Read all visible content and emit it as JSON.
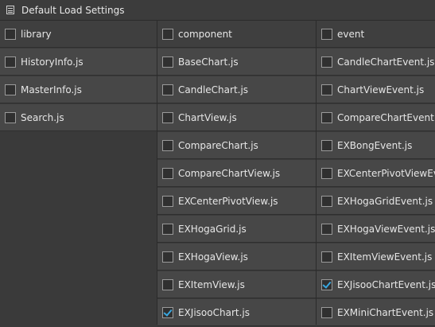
{
  "window": {
    "title": "Default Load Settings",
    "icon": "window-list-icon"
  },
  "columns": [
    {
      "items": [
        {
          "label": "library",
          "checked": false
        },
        {
          "label": "HistoryInfo.js",
          "checked": false
        },
        {
          "label": "MasterInfo.js",
          "checked": false
        },
        {
          "label": "Search.js",
          "checked": false
        }
      ]
    },
    {
      "items": [
        {
          "label": "component",
          "checked": false
        },
        {
          "label": "BaseChart.js",
          "checked": false
        },
        {
          "label": "CandleChart.js",
          "checked": false
        },
        {
          "label": "ChartView.js",
          "checked": false
        },
        {
          "label": "CompareChart.js",
          "checked": false
        },
        {
          "label": "CompareChartView.js",
          "checked": false
        },
        {
          "label": "EXCenterPivotView.js",
          "checked": false
        },
        {
          "label": "EXHogaGrid.js",
          "checked": false
        },
        {
          "label": "EXHogaView.js",
          "checked": false
        },
        {
          "label": "EXItemView.js",
          "checked": false
        },
        {
          "label": "EXJisooChart.js",
          "checked": true
        }
      ]
    },
    {
      "items": [
        {
          "label": "event",
          "checked": false
        },
        {
          "label": "CandleChartEvent.js",
          "checked": false
        },
        {
          "label": "ChartViewEvent.js",
          "checked": false
        },
        {
          "label": "CompareChartEvent.js",
          "checked": false
        },
        {
          "label": "EXBongEvent.js",
          "checked": false
        },
        {
          "label": "EXCenterPivotViewEve",
          "checked": false
        },
        {
          "label": "EXHogaGridEvent.js",
          "checked": false
        },
        {
          "label": "EXHogaViewEvent.js",
          "checked": false
        },
        {
          "label": "EXItemViewEvent.js",
          "checked": false
        },
        {
          "label": "EXJisooChartEvent.js",
          "checked": true
        },
        {
          "label": "EXMiniChartEvent.js",
          "checked": false
        }
      ]
    }
  ],
  "colors": {
    "check_accent": "#39a7e0",
    "background": "#3a3a3a",
    "row": "#474747"
  }
}
